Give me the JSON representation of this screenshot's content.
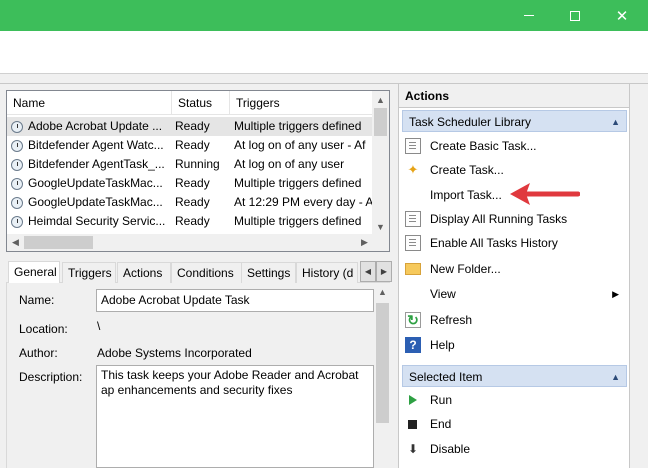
{
  "window": {
    "minimize_icon": "minimize-icon",
    "maximize_icon": "maximize-icon",
    "close_icon": "close-icon",
    "title_bar_color": "#3dbe5a"
  },
  "task_list": {
    "columns": [
      "Name",
      "Status",
      "Triggers"
    ],
    "rows": [
      {
        "name": "Adobe Acrobat Update ...",
        "status": "Ready",
        "triggers": "Multiple triggers defined"
      },
      {
        "name": "Bitdefender Agent Watc...",
        "status": "Ready",
        "triggers": "At log on of any user - Af"
      },
      {
        "name": "Bitdefender AgentTask_...",
        "status": "Running",
        "triggers": "At log on of any user"
      },
      {
        "name": "GoogleUpdateTaskMac...",
        "status": "Ready",
        "triggers": "Multiple triggers defined"
      },
      {
        "name": "GoogleUpdateTaskMac...",
        "status": "Ready",
        "triggers": "At 12:29 PM every day - A"
      },
      {
        "name": "Heimdal Security Servic...",
        "status": "Ready",
        "triggers": "Multiple triggers defined"
      }
    ],
    "selected_row": 0
  },
  "tabs": [
    "General",
    "Triggers",
    "Actions",
    "Conditions",
    "Settings",
    "History (d"
  ],
  "general": {
    "name_label": "Name:",
    "name_value": "Adobe Acrobat Update Task",
    "location_label": "Location:",
    "location_value": "\\",
    "author_label": "Author:",
    "author_value": "Adobe Systems Incorporated",
    "description_label": "Description:",
    "description_value": "This task keeps your Adobe Reader and Acrobat ap enhancements and security fixes"
  },
  "actions": {
    "header": "Actions",
    "library_section": "Task Scheduler Library",
    "library_items": [
      {
        "label": "Create Basic Task...",
        "icon": "create-basic-task-icon"
      },
      {
        "label": "Create Task...",
        "icon": "create-task-icon"
      },
      {
        "label": "Import Task...",
        "icon": "none"
      },
      {
        "label": "Display All Running Tasks",
        "icon": "display-running-icon"
      },
      {
        "label": "Enable All Tasks History",
        "icon": "history-icon"
      },
      {
        "label": "New Folder...",
        "icon": "folder-icon"
      },
      {
        "label": "View",
        "icon": "none"
      },
      {
        "label": "Refresh",
        "icon": "refresh-icon"
      },
      {
        "label": "Help",
        "icon": "help-icon"
      }
    ],
    "selected_section": "Selected Item",
    "selected_items": [
      {
        "label": "Run",
        "icon": "run-icon"
      },
      {
        "label": "End",
        "icon": "end-icon"
      },
      {
        "label": "Disable",
        "icon": "disable-icon"
      }
    ]
  },
  "annotation": {
    "arrow_color": "#e0393e",
    "points_to": "Import Task..."
  }
}
